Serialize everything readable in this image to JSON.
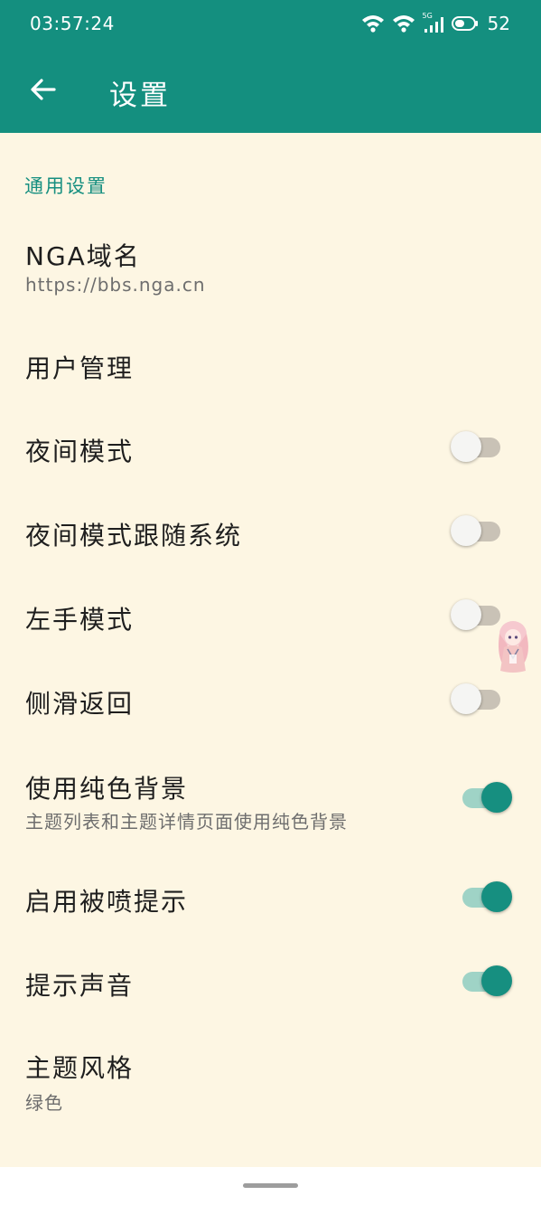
{
  "status_bar": {
    "time": "03:57:24",
    "network_label": "5G",
    "battery": "52"
  },
  "appbar": {
    "title": "设置"
  },
  "section": {
    "header": "通用设置"
  },
  "rows": {
    "nga_domain": {
      "title": "NGA域名",
      "subtitle": "https://bbs.nga.cn"
    },
    "user_manage": {
      "title": "用户管理"
    },
    "night_mode": {
      "title": "夜间模式",
      "on": false
    },
    "night_follow_system": {
      "title": "夜间模式跟随系统",
      "on": false
    },
    "left_hand": {
      "title": "左手模式",
      "on": false
    },
    "swipe_back": {
      "title": "侧滑返回",
      "on": false
    },
    "solid_bg": {
      "title": "使用纯色背景",
      "subtitle": "主题列表和主题详情页面使用纯色背景",
      "on": true
    },
    "sprayed_tip": {
      "title": "启用被喷提示",
      "on": true
    },
    "tip_sound": {
      "title": "提示声音",
      "on": true
    },
    "theme_style": {
      "title": "主题风格",
      "subtitle": "绿色"
    }
  },
  "colors": {
    "accent": "#148f7f",
    "background": "#fdf6e3",
    "switch_on_track": "#9fd3c6",
    "switch_off_track": "#c9c2b6"
  }
}
